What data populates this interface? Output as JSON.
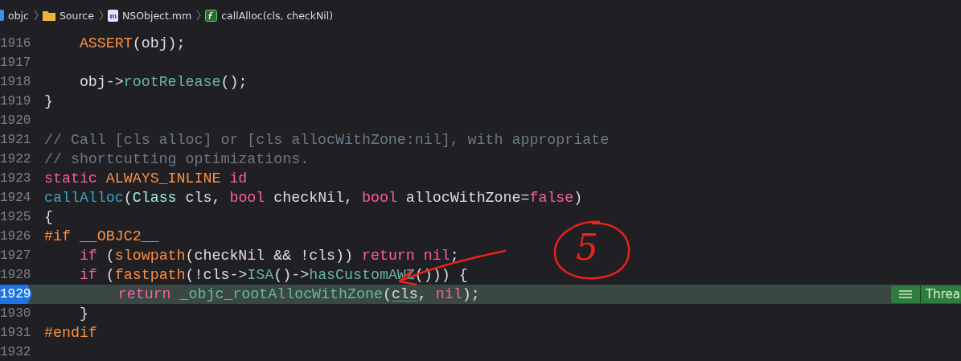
{
  "breadcrumb": [
    {
      "kind": "project",
      "label": "objc"
    },
    {
      "kind": "folder",
      "label": "Source"
    },
    {
      "kind": "source-file",
      "label": "NSObject.mm"
    },
    {
      "kind": "function",
      "label": "callAlloc(cls, checkNil)"
    }
  ],
  "lines": [
    {
      "number": "1916",
      "current": false,
      "tokens": [
        {
          "kind": "macro",
          "text": "    ASSERT"
        },
        {
          "kind": "plain",
          "text": "(obj);"
        }
      ]
    },
    {
      "number": "1917",
      "current": false
    },
    {
      "number": "1918",
      "current": false,
      "tokens": [
        {
          "kind": "plain",
          "text": "    obj->"
        },
        {
          "kind": "method",
          "text": "rootRelease"
        },
        {
          "kind": "plain",
          "text": "();"
        }
      ]
    },
    {
      "number": "1919",
      "current": false,
      "tokens": [
        {
          "kind": "plain",
          "text": "}"
        }
      ]
    },
    {
      "number": "1920",
      "current": false
    },
    {
      "number": "1921",
      "current": false,
      "tokens": [
        {
          "kind": "comment",
          "text": "// Call [cls alloc] or [cls allocWithZone:nil], with appropriate"
        }
      ]
    },
    {
      "number": "1922",
      "current": false,
      "tokens": [
        {
          "kind": "comment",
          "text": "// shortcutting optimizations."
        }
      ]
    },
    {
      "number": "1923",
      "current": false,
      "tokens": [
        {
          "kind": "keyword",
          "text": "static"
        },
        {
          "kind": "macro",
          "text": " ALWAYS_INLINE"
        },
        {
          "kind": "keyword",
          "text": " id"
        }
      ]
    },
    {
      "number": "1924",
      "current": false,
      "tokens": [
        {
          "kind": "declaration",
          "text": "callAlloc"
        },
        {
          "kind": "plain",
          "text": "("
        },
        {
          "kind": "type",
          "text": "Class"
        },
        {
          "kind": "plain",
          "text": " cls, "
        },
        {
          "kind": "keyword",
          "text": "bool"
        },
        {
          "kind": "plain",
          "text": " checkNil, "
        },
        {
          "kind": "keyword",
          "text": "bool"
        },
        {
          "kind": "plain",
          "text": " allocWithZone="
        },
        {
          "kind": "keyword",
          "text": "false"
        },
        {
          "kind": "plain",
          "text": ")"
        }
      ]
    },
    {
      "number": "1925",
      "current": false,
      "tokens": [
        {
          "kind": "plain",
          "text": "{"
        }
      ]
    },
    {
      "number": "1926",
      "current": false,
      "tokens": [
        {
          "kind": "macro",
          "text": "#if __OBJC2__"
        }
      ]
    },
    {
      "number": "1927",
      "current": false,
      "tokens": [
        {
          "kind": "keyword",
          "text": "    if"
        },
        {
          "kind": "plain",
          "text": " ("
        },
        {
          "kind": "macro",
          "text": "slowpath"
        },
        {
          "kind": "plain",
          "text": "(checkNil && !cls)) "
        },
        {
          "kind": "keyword",
          "text": "return nil"
        },
        {
          "kind": "plain",
          "text": ";"
        }
      ]
    },
    {
      "number": "1928",
      "current": false,
      "tokens": [
        {
          "kind": "keyword",
          "text": "    if"
        },
        {
          "kind": "plain",
          "text": " ("
        },
        {
          "kind": "macro",
          "text": "fastpath"
        },
        {
          "kind": "plain",
          "text": "(!cls->"
        },
        {
          "kind": "method",
          "text": "ISA"
        },
        {
          "kind": "plain",
          "text": "()->"
        },
        {
          "kind": "method",
          "text": "hasCustomAWZ"
        },
        {
          "kind": "plain",
          "text": "())) {"
        }
      ]
    },
    {
      "number": "1929",
      "current": true,
      "badge": "Threa",
      "tokens": [
        {
          "kind": "keyword",
          "text": "        return"
        },
        {
          "kind": "method",
          "text": " _objc_rootAllocWithZone"
        },
        {
          "kind": "plain",
          "text": "("
        },
        {
          "kind": "plain",
          "text": "cls",
          "underline": true
        },
        {
          "kind": "plain",
          "text": ", "
        },
        {
          "kind": "keyword",
          "text": "nil"
        },
        {
          "kind": "plain",
          "text": ");"
        }
      ]
    },
    {
      "number": "1930",
      "current": false,
      "tokens": [
        {
          "kind": "plain",
          "text": "    }"
        }
      ]
    },
    {
      "number": "1931",
      "current": false,
      "tokens": [
        {
          "kind": "macro",
          "text": "#endif"
        }
      ]
    },
    {
      "number": "1932",
      "current": false
    }
  ],
  "annotation": {
    "circled": "5"
  }
}
